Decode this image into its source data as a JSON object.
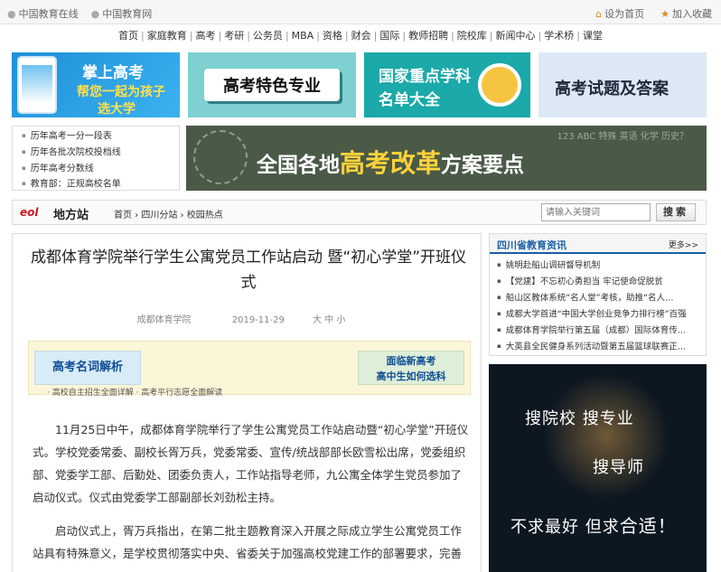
{
  "topbar": {
    "links": [
      "中国教育在线",
      "中国教育网"
    ],
    "set_home": "设为首页",
    "add_fav": "加入收藏"
  },
  "nav": {
    "items": [
      "首页",
      "家庭教育",
      "高考",
      "考研",
      "公务员",
      "MBA",
      "资格",
      "财会",
      "国际",
      "教师招聘",
      "院校库",
      "新闻中心",
      "学术桥",
      "课堂"
    ]
  },
  "banners": {
    "b1": {
      "line1": "掌上高考",
      "line2": "帮您一起为孩子",
      "line3": "选大学"
    },
    "b2": {
      "text": "高考特色专业"
    },
    "b3": {
      "line1": "国家重点学科",
      "line2": "名单大全"
    },
    "b4": {
      "text": "高考试题及答案"
    }
  },
  "quicklinks": [
    "历年高考一分一段表",
    "历年各批次院校投档线",
    "历年高考分数线",
    "教育部：正规高校名单"
  ],
  "bigbanner": {
    "pre": "全国各地",
    "highlight": "高考改革",
    "post": "方案要点",
    "chalk": "123 ABC 特殊 英语 化学 历史？"
  },
  "local": {
    "logo": "eol",
    "name": "地方站",
    "breadcrumb": "首页 › 四川分站 › 校园热点",
    "search_placeholder": "请输入关键词",
    "search_button": "搜索"
  },
  "article": {
    "title": "成都体育学院举行学生公寓党员工作站启动 暨“初心学堂”开班仪式",
    "source": "成都体育学院",
    "date": "2019-11-29",
    "font_size": "大 中 小",
    "ad_left": "高考名词解析",
    "ad_right_1": "面临新高考",
    "ad_right_2": "高中生如何选科",
    "ad_links": "· 高校自主招生全面详解 · 高考平行志愿全面解读",
    "paragraphs": [
      "11月25日中午，成都体育学院举行了学生公寓党员工作站启动暨“初心学堂”开班仪式。学校党委常委、副校长胥万兵，党委常委、宣传/统战部部长欧雪松出席，党委组织部、党委学工部、后勤处、团委负责人，工作站指导老师，九公寓全体学生党员参加了启动仪式。仪式由党委学工部副部长刘劲松主持。",
      "启动仪式上，胥万兵指出，在第二批主题教育深入开展之际成立学生公寓党员工作站具有特殊意义，是学校贯彻落实中央、省委关于加强高校党建工作的部署要求，完善"
    ]
  },
  "news": {
    "title": "四川省教育资讯",
    "more": "更多>>",
    "items": [
      "姚明赴船山调研督导机制",
      "【党建】不忘初心勇担当 牢记使命促脱贫",
      "船山区教体系统“名人堂”考核，助推“名人…",
      "成都大学首进“中国大学创业竞争力排行榜”百强",
      "成都体育学院举行第五届（成都）国际体育传…",
      "大英县全民健身系列活动暨第五届篮球联赛正…"
    ]
  },
  "sidead": {
    "line1": "搜院校 搜专业",
    "line2": "搜导师",
    "line3a": "不求最好 但求",
    "line3b": "合适！"
  },
  "colors": {
    "accent": "#1a5fa8",
    "brand_red": "#c8161d",
    "highlight": "#ffd23a"
  }
}
